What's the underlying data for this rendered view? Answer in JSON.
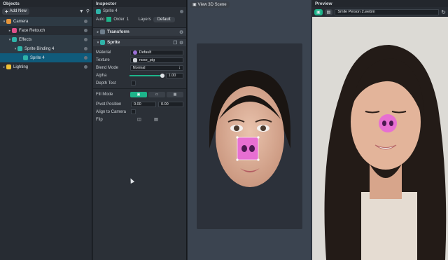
{
  "objects": {
    "title": "Objects",
    "add_new": "Add New",
    "items": [
      {
        "label": "Camera",
        "indent": 0,
        "state": "hl",
        "icon_color": "#e7963b"
      },
      {
        "label": "Face Retouch",
        "indent": 1,
        "state": "",
        "icon_color": "#e04f8a"
      },
      {
        "label": "Effects",
        "indent": 1,
        "state": "hl",
        "icon_color": "#2fb3a8"
      },
      {
        "label": "Sprite Binding 4",
        "indent": 2,
        "state": "hl",
        "icon_color": "#2fb3a8"
      },
      {
        "label": "Sprite 4",
        "indent": 3,
        "state": "selected",
        "icon_color": "#2fb3a8"
      },
      {
        "label": "Lighting",
        "indent": 0,
        "state": "",
        "icon_color": "#f0c237"
      }
    ]
  },
  "inspector": {
    "title": "Inspector",
    "object_name": "Sprite 4",
    "auto_label": "Auto",
    "order_label": "Order",
    "order_value": "1",
    "layers_label": "Layers",
    "layers_value": "Default",
    "transform_label": "Transform",
    "sprite_label": "Sprite",
    "material_label": "Material",
    "material_value": "Default",
    "texture_label": "Texture",
    "texture_value": "nose_pig",
    "blend_label": "Blend Mode",
    "blend_value": "Normal",
    "alpha_label": "Alpha",
    "alpha_value": "1.00",
    "depth_label": "Depth Test",
    "fill_label": "Fill Mode",
    "pivot_label": "Pivot Position",
    "pivot_x": "0.00",
    "pivot_y": "0.00",
    "align_label": "Align to Camera",
    "flip_label": "Flip"
  },
  "scene": {
    "button": "View 3D Scene"
  },
  "preview": {
    "title": "Preview",
    "file": "Smile Person 2.webm"
  },
  "colors": {
    "accent": "#1db48a",
    "selection": "#105b7b",
    "pig_pink": "#e76fd2"
  }
}
